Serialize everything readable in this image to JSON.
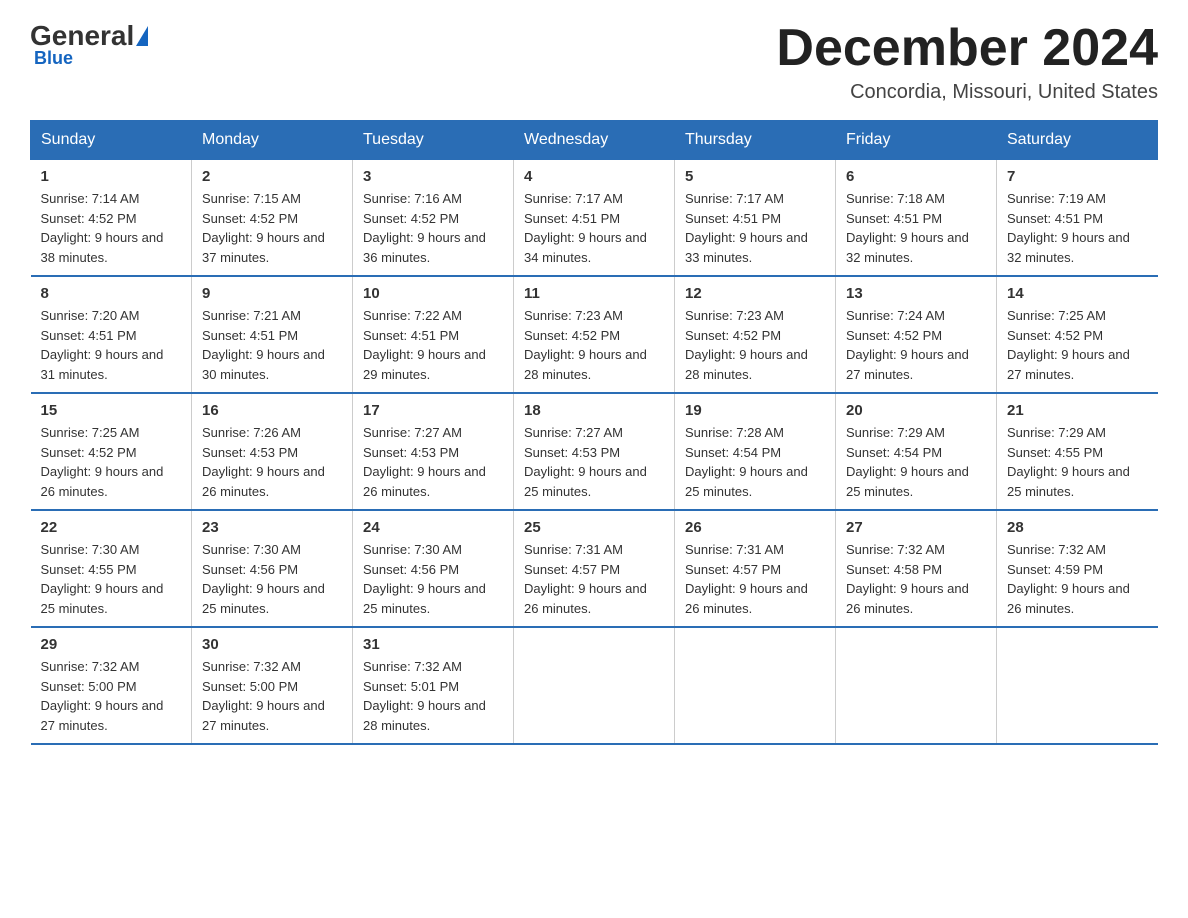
{
  "logo": {
    "general": "General",
    "blue": "Blue",
    "underline": "Blue"
  },
  "header": {
    "title": "December 2024",
    "location": "Concordia, Missouri, United States"
  },
  "weekdays": [
    "Sunday",
    "Monday",
    "Tuesday",
    "Wednesday",
    "Thursday",
    "Friday",
    "Saturday"
  ],
  "weeks": [
    [
      {
        "day": "1",
        "sunrise": "7:14 AM",
        "sunset": "4:52 PM",
        "daylight": "9 hours and 38 minutes."
      },
      {
        "day": "2",
        "sunrise": "7:15 AM",
        "sunset": "4:52 PM",
        "daylight": "9 hours and 37 minutes."
      },
      {
        "day": "3",
        "sunrise": "7:16 AM",
        "sunset": "4:52 PM",
        "daylight": "9 hours and 36 minutes."
      },
      {
        "day": "4",
        "sunrise": "7:17 AM",
        "sunset": "4:51 PM",
        "daylight": "9 hours and 34 minutes."
      },
      {
        "day": "5",
        "sunrise": "7:17 AM",
        "sunset": "4:51 PM",
        "daylight": "9 hours and 33 minutes."
      },
      {
        "day": "6",
        "sunrise": "7:18 AM",
        "sunset": "4:51 PM",
        "daylight": "9 hours and 32 minutes."
      },
      {
        "day": "7",
        "sunrise": "7:19 AM",
        "sunset": "4:51 PM",
        "daylight": "9 hours and 32 minutes."
      }
    ],
    [
      {
        "day": "8",
        "sunrise": "7:20 AM",
        "sunset": "4:51 PM",
        "daylight": "9 hours and 31 minutes."
      },
      {
        "day": "9",
        "sunrise": "7:21 AM",
        "sunset": "4:51 PM",
        "daylight": "9 hours and 30 minutes."
      },
      {
        "day": "10",
        "sunrise": "7:22 AM",
        "sunset": "4:51 PM",
        "daylight": "9 hours and 29 minutes."
      },
      {
        "day": "11",
        "sunrise": "7:23 AM",
        "sunset": "4:52 PM",
        "daylight": "9 hours and 28 minutes."
      },
      {
        "day": "12",
        "sunrise": "7:23 AM",
        "sunset": "4:52 PM",
        "daylight": "9 hours and 28 minutes."
      },
      {
        "day": "13",
        "sunrise": "7:24 AM",
        "sunset": "4:52 PM",
        "daylight": "9 hours and 27 minutes."
      },
      {
        "day": "14",
        "sunrise": "7:25 AM",
        "sunset": "4:52 PM",
        "daylight": "9 hours and 27 minutes."
      }
    ],
    [
      {
        "day": "15",
        "sunrise": "7:25 AM",
        "sunset": "4:52 PM",
        "daylight": "9 hours and 26 minutes."
      },
      {
        "day": "16",
        "sunrise": "7:26 AM",
        "sunset": "4:53 PM",
        "daylight": "9 hours and 26 minutes."
      },
      {
        "day": "17",
        "sunrise": "7:27 AM",
        "sunset": "4:53 PM",
        "daylight": "9 hours and 26 minutes."
      },
      {
        "day": "18",
        "sunrise": "7:27 AM",
        "sunset": "4:53 PM",
        "daylight": "9 hours and 25 minutes."
      },
      {
        "day": "19",
        "sunrise": "7:28 AM",
        "sunset": "4:54 PM",
        "daylight": "9 hours and 25 minutes."
      },
      {
        "day": "20",
        "sunrise": "7:29 AM",
        "sunset": "4:54 PM",
        "daylight": "9 hours and 25 minutes."
      },
      {
        "day": "21",
        "sunrise": "7:29 AM",
        "sunset": "4:55 PM",
        "daylight": "9 hours and 25 minutes."
      }
    ],
    [
      {
        "day": "22",
        "sunrise": "7:30 AM",
        "sunset": "4:55 PM",
        "daylight": "9 hours and 25 minutes."
      },
      {
        "day": "23",
        "sunrise": "7:30 AM",
        "sunset": "4:56 PM",
        "daylight": "9 hours and 25 minutes."
      },
      {
        "day": "24",
        "sunrise": "7:30 AM",
        "sunset": "4:56 PM",
        "daylight": "9 hours and 25 minutes."
      },
      {
        "day": "25",
        "sunrise": "7:31 AM",
        "sunset": "4:57 PM",
        "daylight": "9 hours and 26 minutes."
      },
      {
        "day": "26",
        "sunrise": "7:31 AM",
        "sunset": "4:57 PM",
        "daylight": "9 hours and 26 minutes."
      },
      {
        "day": "27",
        "sunrise": "7:32 AM",
        "sunset": "4:58 PM",
        "daylight": "9 hours and 26 minutes."
      },
      {
        "day": "28",
        "sunrise": "7:32 AM",
        "sunset": "4:59 PM",
        "daylight": "9 hours and 26 minutes."
      }
    ],
    [
      {
        "day": "29",
        "sunrise": "7:32 AM",
        "sunset": "5:00 PM",
        "daylight": "9 hours and 27 minutes."
      },
      {
        "day": "30",
        "sunrise": "7:32 AM",
        "sunset": "5:00 PM",
        "daylight": "9 hours and 27 minutes."
      },
      {
        "day": "31",
        "sunrise": "7:32 AM",
        "sunset": "5:01 PM",
        "daylight": "9 hours and 28 minutes."
      },
      null,
      null,
      null,
      null
    ]
  ],
  "labels": {
    "sunrise": "Sunrise: ",
    "sunset": "Sunset: ",
    "daylight": "Daylight: "
  }
}
